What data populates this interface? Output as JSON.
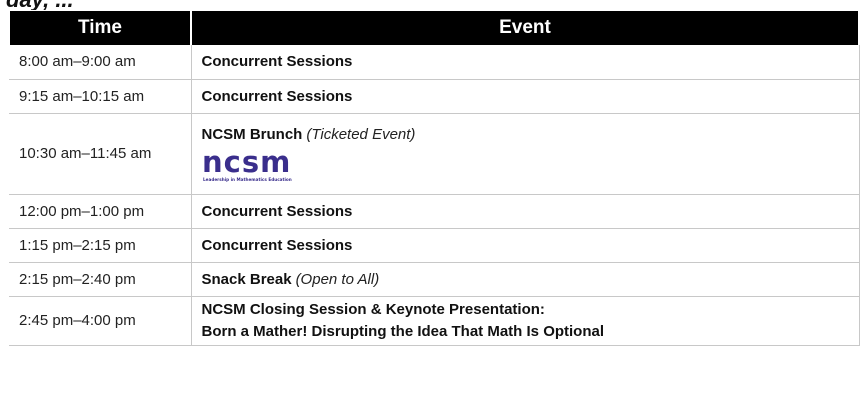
{
  "table": {
    "headers": {
      "time": "Time",
      "event": "Event"
    },
    "rows": [
      {
        "time": "8:00 am–9:00 am",
        "event": "Concurrent Sessions"
      },
      {
        "time": "9:15 am–10:15 am",
        "event": "Concurrent Sessions"
      },
      {
        "time": "10:30 am–11:45 am",
        "event": "NCSM Brunch",
        "note": "(Ticketed Event)"
      },
      {
        "time": "12:00 pm–1:00 pm",
        "event": "Concurrent Sessions"
      },
      {
        "time": "1:15 pm–2:15 pm",
        "event": "Concurrent Sessions"
      },
      {
        "time": "2:15 pm–2:40 pm",
        "event": "Snack Break",
        "note": "(Open to All)"
      },
      {
        "time": "2:45 pm–4:00 pm",
        "event": "NCSM Closing Session & Keynote Presentation:",
        "event_line2": "Born a Mather! Disrupting the Idea That Math Is Optional"
      }
    ]
  },
  "logo": {
    "text": "ncsm",
    "tagline": "Leadership in Mathematics Education",
    "color": "#3a2e8c"
  },
  "colors": {
    "header_bg": "#000000",
    "header_text": "#ffffff",
    "grid": "#c8c8c8"
  }
}
